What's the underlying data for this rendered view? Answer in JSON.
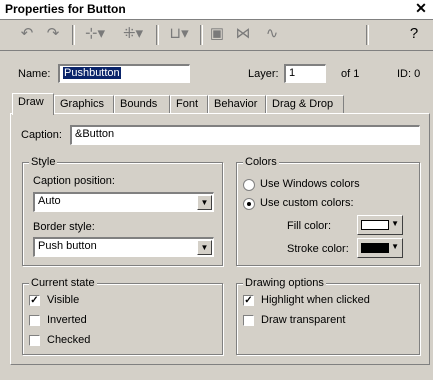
{
  "window": {
    "title": "Properties for Button",
    "close_glyph": "✕"
  },
  "toolbar": {
    "icons": [
      "undo-icon",
      "redo-icon",
      "align-icon",
      "distribute-icon",
      "ruler-icon",
      "page-icon",
      "connect-icon",
      "node-icon",
      "help-icon"
    ],
    "help_label": "?"
  },
  "header": {
    "name_label": "Name:",
    "name_value": "Pushbutton",
    "layer_label": "Layer:",
    "layer_value": "1",
    "layer_of": "of 1",
    "id_label": "ID: 0"
  },
  "tabs": [
    {
      "label": "Draw",
      "active": true
    },
    {
      "label": "Graphics"
    },
    {
      "label": "Bounds"
    },
    {
      "label": "Font"
    },
    {
      "label": "Behavior"
    },
    {
      "label": "Drag & Drop"
    }
  ],
  "draw": {
    "caption_label": "Caption:",
    "caption_value": "&Button",
    "style": {
      "title": "Style",
      "caption_position_label": "Caption position:",
      "caption_position_value": "Auto",
      "border_style_label": "Border style:",
      "border_style_value": "Push button"
    },
    "colors": {
      "title": "Colors",
      "windows_label": "Use Windows colors",
      "custom_label": "Use custom colors:",
      "selected": "custom",
      "fill_label": "Fill color:",
      "fill_color": "#ffffff",
      "stroke_label": "Stroke color:",
      "stroke_color": "#000000"
    },
    "current_state": {
      "title": "Current state",
      "visible_label": "Visible",
      "visible_checked": true,
      "inverted_label": "Inverted",
      "inverted_checked": false,
      "checked_label": "Checked",
      "checked_checked": false
    },
    "drawing_options": {
      "title": "Drawing options",
      "highlight_label": "Highlight when clicked",
      "highlight_checked": true,
      "transparent_label": "Draw transparent",
      "transparent_checked": false
    }
  }
}
